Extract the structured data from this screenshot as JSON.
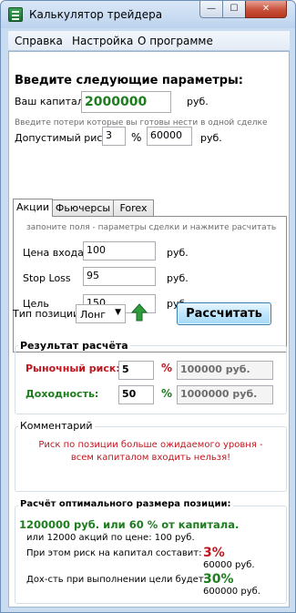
{
  "window": {
    "title": "Калькулятор  трейдера",
    "min_glyph": "—",
    "max_glyph": "☐",
    "close_glyph": "✕"
  },
  "menu": [
    "Справка",
    "Настройка",
    "О программе"
  ],
  "params": {
    "heading": "Введите следующие параметры:",
    "capital_label": "Ваш капитал",
    "capital_value": "2000000",
    "capital_unit": "руб.",
    "risk_hint": "Введите потери которые вы готовы нести в одной сделке",
    "risk_label": "Допустимый риск",
    "risk_percent": "3",
    "percent_sign": "%",
    "risk_amount": "60000",
    "risk_unit": "руб."
  },
  "tabs": [
    "Акции",
    "Фьючерсы",
    "Forex"
  ],
  "tab_panel": {
    "hint": "запоните поля - параметры сделки и нажмите расчитать",
    "fields": [
      {
        "label": "Цена входа",
        "value": "100",
        "unit": "руб."
      },
      {
        "label": "Stop Loss",
        "value": "95",
        "unit": "руб."
      },
      {
        "label": "Цель",
        "value": "150",
        "unit": "руб."
      }
    ]
  },
  "position": {
    "label": "Тип позиции",
    "selected": "Лонг",
    "calc_button": "Рассчитать"
  },
  "result": {
    "title": "Результат расчёта",
    "market_risk_label": "Рыночный риск:",
    "market_risk_value": "5",
    "market_risk_percent": "%",
    "market_risk_amount": "100000 руб.",
    "yield_label": "Доходность:",
    "yield_value": "50",
    "yield_percent": "%",
    "yield_amount": "1000000 руб."
  },
  "comment": {
    "title": "Комментарий",
    "line1": "Риск по позиции больше ожидаемого уровня -",
    "line2": "всем капиталом входить нельзя!"
  },
  "optimal": {
    "title": "Расчёт оптимального размера позиции:",
    "main": "1200000 руб. или 60 % от капитала.",
    "sub": "или 12000 акций по цене: 100 руб.",
    "risk_label": "При этом риск на капитал составит:",
    "risk_percent": "3%",
    "risk_amount": "60000 руб.",
    "yield_label": "Дох-сть при выполнении цели будет:",
    "yield_percent": "30%",
    "yield_amount": "600000 руб."
  },
  "colors": {
    "accent_green": "#1e7d1e",
    "accent_red": "#c0171f"
  },
  "icons": {
    "app": "calculator-icon",
    "direction": "green-up-arrow-icon"
  }
}
